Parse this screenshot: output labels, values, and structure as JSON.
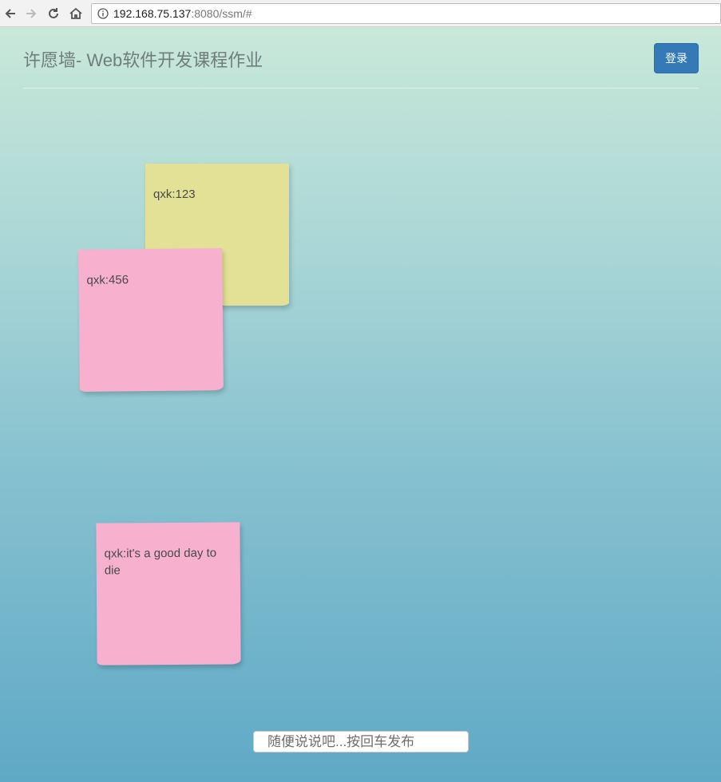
{
  "browser": {
    "host": "192.168.75.137",
    "path": ":8080/ssm/#"
  },
  "header": {
    "title": "许愿墙- Web软件开发课程作业",
    "login_label": "登录"
  },
  "notes": [
    {
      "text": "qxk:123",
      "color": "#e2e196"
    },
    {
      "text": "qxk:456",
      "color": "#f7b1cf"
    },
    {
      "text": "qxk:it's a good day to die",
      "color": "#f7b1cf"
    }
  ],
  "wish_input": {
    "placeholder": "随便说说吧...按回车发布"
  },
  "colors": {
    "accent": "#337ab7",
    "gradient_top": "#c9e8d9",
    "gradient_bottom": "#5fa9c6"
  }
}
